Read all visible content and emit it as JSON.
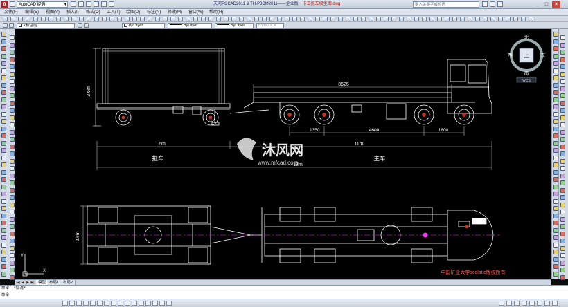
{
  "window": {
    "app_button": "A",
    "workspace": "AutoCAD 经典",
    "title": "天河PCCAD2011 & TH-P3DM2011——企业版",
    "file": "卡车拖车模型图.dwg",
    "search_placeholder": "键入关键字或短语",
    "minimize": "_",
    "maximize": "□",
    "close": "×"
  },
  "menus": [
    "文件(F)",
    "编辑(E)",
    "视图(V)",
    "插入(I)",
    "格式(O)",
    "工具(T)",
    "绘图(D)",
    "标注(N)",
    "修改(M)",
    "窗口(W)",
    "帮助(H)"
  ],
  "toolbar": {
    "layer": "7标注层",
    "color": "ByLayer",
    "linetype": "ByLayer",
    "lineweight": "ByLayer",
    "plotstyle": "BYBLOCK"
  },
  "viewcube": {
    "north": "北",
    "south": "南",
    "east": "东",
    "west": "西",
    "face": "上",
    "wcs": "WCS"
  },
  "drawing": {
    "dim_8625": "8625",
    "dim_height": "3.6m",
    "dim_1350": "1350",
    "dim_4600": "4600",
    "dim_1800": "1800",
    "dim_6m": "6m",
    "dim_11m": "11m",
    "dim_18m": "18m",
    "dim_2_6m": "2.6m",
    "label_trailer": "拖车",
    "label_truck": "主车",
    "watermark_brand": "沐风网",
    "watermark_url": "www.mfcad.com",
    "copyright": "中国矿业大学scolatic版权所有",
    "ucs_y": "Y",
    "ucs_x": "X"
  },
  "tabs": {
    "model": "模型",
    "layout1": "布局1",
    "layout2": "布局2"
  },
  "command": {
    "line1": "命令: *取消*",
    "line2": "命令:"
  },
  "colors": {
    "accent_red": "#cc3322",
    "drawing_white": "#ffffff",
    "drawing_gray": "#bbbbbb",
    "magenta": "#ff30ff",
    "canvas": "#000000"
  }
}
